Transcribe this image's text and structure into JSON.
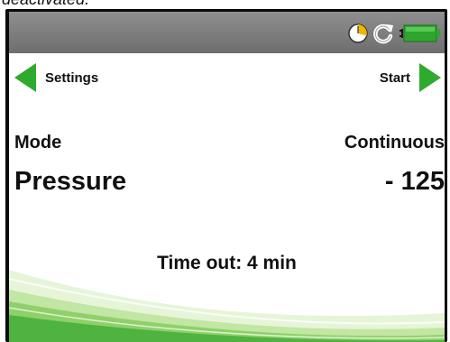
{
  "caption": "deactivated.",
  "status_icons": [
    "timer-icon",
    "refresh-icon",
    "battery-icon"
  ],
  "nav": {
    "back_label": "Settings",
    "forward_label": "Start"
  },
  "mode": {
    "label": "Mode",
    "value": "Continuous"
  },
  "pressure": {
    "label": "Pressure",
    "value": "- 125"
  },
  "timeout_text": "Time out: 4 min",
  "colors": {
    "accent_green": "#2eaa2e",
    "status_bar": "#7f7f7f",
    "bezel": "#0a0a0a"
  }
}
